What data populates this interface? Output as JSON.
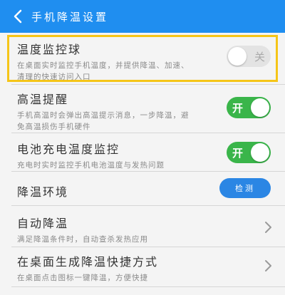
{
  "header": {
    "title": "手机降温设置",
    "back_icon": "chevron-left-icon",
    "color": "#1f8ef0"
  },
  "settings": [
    {
      "title": "温度监控球",
      "desc1": "在桌面实时监控手机温度，并提供降温、加速、",
      "desc2": "清理的快速访问入口",
      "toggle": "关",
      "state": "off",
      "highlighted": true
    },
    {
      "title": "高温提醒",
      "desc1": "手机高温时会弹出高温提示消息，一步降温，避",
      "desc2": "免高温损伤手机硬件",
      "toggle": "开",
      "state": "on"
    },
    {
      "title": "电池充电温度监控",
      "desc1": "充电时实时监控手机电池温度与发热问题",
      "toggle": "开",
      "state": "on"
    },
    {
      "title": "降温环境",
      "button": "检测"
    },
    {
      "title": "自动降温",
      "desc1": "满足降温条件时，自动查杀发热应用"
    },
    {
      "title": "在桌面生成降温快捷方式",
      "desc1": "在桌面点击图标一键降温，方便快捷"
    }
  ],
  "colors": {
    "accent": "#1f8ef0",
    "toggle_on": "#3ab54a",
    "highlight_border": "#f5c518",
    "button": "#2b86e4"
  }
}
